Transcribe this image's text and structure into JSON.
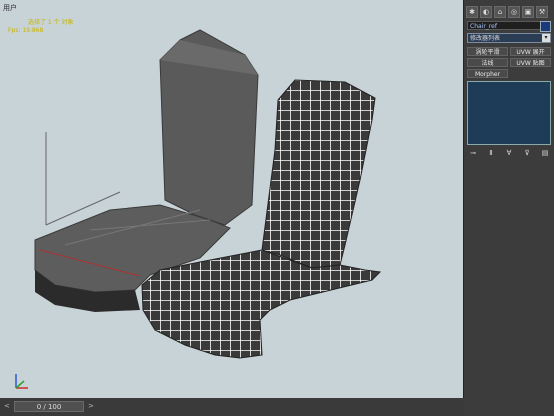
{
  "viewport": {
    "label": "用户",
    "info_line1": "选择了 1 个 对象",
    "info_line2": "Fps: 19.868"
  },
  "command_panel": {
    "toolbar_icons": [
      "create-icon",
      "modify-icon",
      "hierarchy-icon",
      "motion-icon",
      "display-icon",
      "utilities-icon"
    ],
    "object_name": "Chair_ref",
    "modifier_list": "修改器列表",
    "buttons": {
      "turbosmooth": "涡轮平滑",
      "uvw_unwrap": "UVW 展开",
      "normal": "法线",
      "uvw_map": "UVW 贴图",
      "morpher": "Morpher"
    },
    "stack_tools": [
      "pin-icon",
      "show-end-icon",
      "unique-icon",
      "remove-icon",
      "configure-icon"
    ]
  },
  "timeline": {
    "frame_display": "0 / 100"
  },
  "colors": {
    "viewport_bg": "#c8d3d8",
    "panel_bg": "#3c3c3c",
    "accent_blue": "#2b3d55",
    "info_text": "#c8b400"
  }
}
